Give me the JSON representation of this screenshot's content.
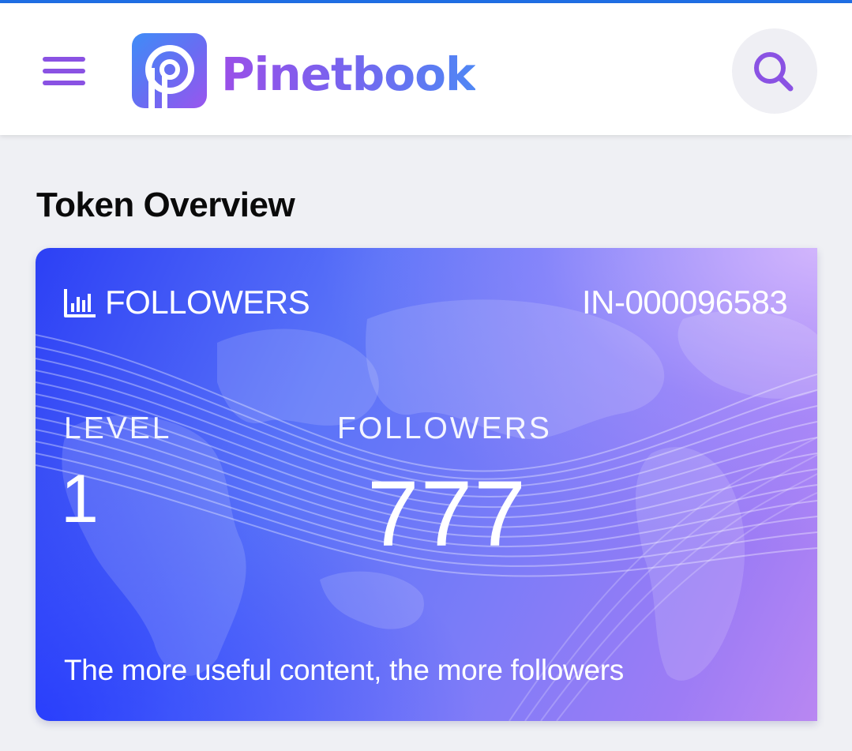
{
  "header": {
    "menu_icon": "hamburger-menu-icon",
    "logo_icon": "pinetbook-logo-icon",
    "brand_name": "Pinetbook",
    "search_icon": "search-icon",
    "accent_color": "#8a52e3"
  },
  "section": {
    "title": "Token Overview"
  },
  "card": {
    "type_icon": "bar-chart-icon",
    "type_label": "FOLLOWERS",
    "id": "IN-000096583",
    "level_label": "LEVEL",
    "level_value": "1",
    "followers_label": "FOLLOWERS",
    "followers_value": "777",
    "tagline": "The more useful content, the more followers",
    "gradient_start": "#2c40f5",
    "gradient_end": "#b987f2"
  }
}
